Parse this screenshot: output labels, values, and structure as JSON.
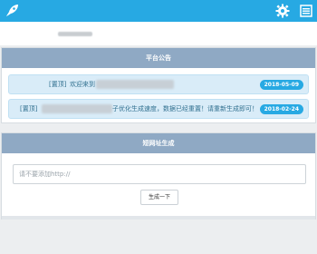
{
  "topbar": {
    "logo_icon": "rocket-icon",
    "settings_icon": "gear-icon",
    "menu_icon": "list-menu-icon",
    "color": "#27a9e3"
  },
  "notice_panel": {
    "title": "平台公告",
    "items": [
      {
        "tag": "[置顶]",
        "text_before": "欢迎来到",
        "text_after": "",
        "date": "2018-05-09"
      },
      {
        "tag": "[置顶]",
        "text_before": "",
        "text_after": "子优化生成速度，数据已经重置！请重新生成即可！",
        "date": "2018-02-24"
      }
    ]
  },
  "generate_panel": {
    "title": "短网址生成",
    "input_placeholder": "请不要添加http://",
    "input_value": "",
    "button_label": "生成一下"
  },
  "colors": {
    "accent": "#27a9e3",
    "panel_header": "#8fa9c4",
    "notice_bg": "#d9ecf8",
    "notice_text": "#31708f",
    "date_badge": "#27a9e3"
  }
}
